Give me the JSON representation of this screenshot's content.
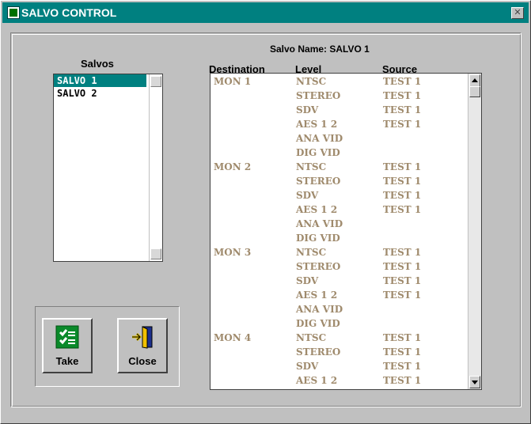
{
  "window": {
    "title": "SALVO CONTROL"
  },
  "salvo_name_line": "Salvo Name: SALVO 1",
  "salvos": {
    "label": "Salvos",
    "items": [
      "SALVO 1",
      "SALVO 2"
    ],
    "selected": "SALVO 1"
  },
  "headers": {
    "destination": "Destination",
    "level": "Level",
    "source": "Source"
  },
  "routes": [
    {
      "dest": "MON 1",
      "level": "NTSC",
      "source": "TEST 1"
    },
    {
      "dest": "",
      "level": "STEREO",
      "source": "TEST 1"
    },
    {
      "dest": "",
      "level": "SDV",
      "source": "TEST 1"
    },
    {
      "dest": "",
      "level": "AES 1 2",
      "source": "TEST 1"
    },
    {
      "dest": "",
      "level": "ANA VID",
      "source": ""
    },
    {
      "dest": "",
      "level": "DIG VID",
      "source": ""
    },
    {
      "dest": "MON 2",
      "level": "NTSC",
      "source": "TEST 1"
    },
    {
      "dest": "",
      "level": "STEREO",
      "source": "TEST 1"
    },
    {
      "dest": "",
      "level": "SDV",
      "source": "TEST 1"
    },
    {
      "dest": "",
      "level": "AES 1 2",
      "source": "TEST 1"
    },
    {
      "dest": "",
      "level": "ANA VID",
      "source": ""
    },
    {
      "dest": "",
      "level": "DIG VID",
      "source": ""
    },
    {
      "dest": "MON 3",
      "level": "NTSC",
      "source": "TEST 1"
    },
    {
      "dest": "",
      "level": "STEREO",
      "source": "TEST 1"
    },
    {
      "dest": "",
      "level": "SDV",
      "source": "TEST 1"
    },
    {
      "dest": "",
      "level": "AES 1 2",
      "source": "TEST 1"
    },
    {
      "dest": "",
      "level": "ANA VID",
      "source": ""
    },
    {
      "dest": "",
      "level": "DIG VID",
      "source": ""
    },
    {
      "dest": "MON 4",
      "level": "NTSC",
      "source": "TEST 1"
    },
    {
      "dest": "",
      "level": "STEREO",
      "source": "TEST 1"
    },
    {
      "dest": "",
      "level": "SDV",
      "source": "TEST 1"
    },
    {
      "dest": "",
      "level": "AES 1 2",
      "source": "TEST 1"
    }
  ],
  "buttons": {
    "take": "Take",
    "close": "Close"
  },
  "colors": {
    "titlebar": "#008080",
    "route_text": "#9f8a6c",
    "selection": "#008080"
  },
  "icons": {
    "app": "green-app-icon",
    "close_window": "close-icon",
    "take": "take-checklist-icon",
    "close": "exit-door-icon"
  }
}
